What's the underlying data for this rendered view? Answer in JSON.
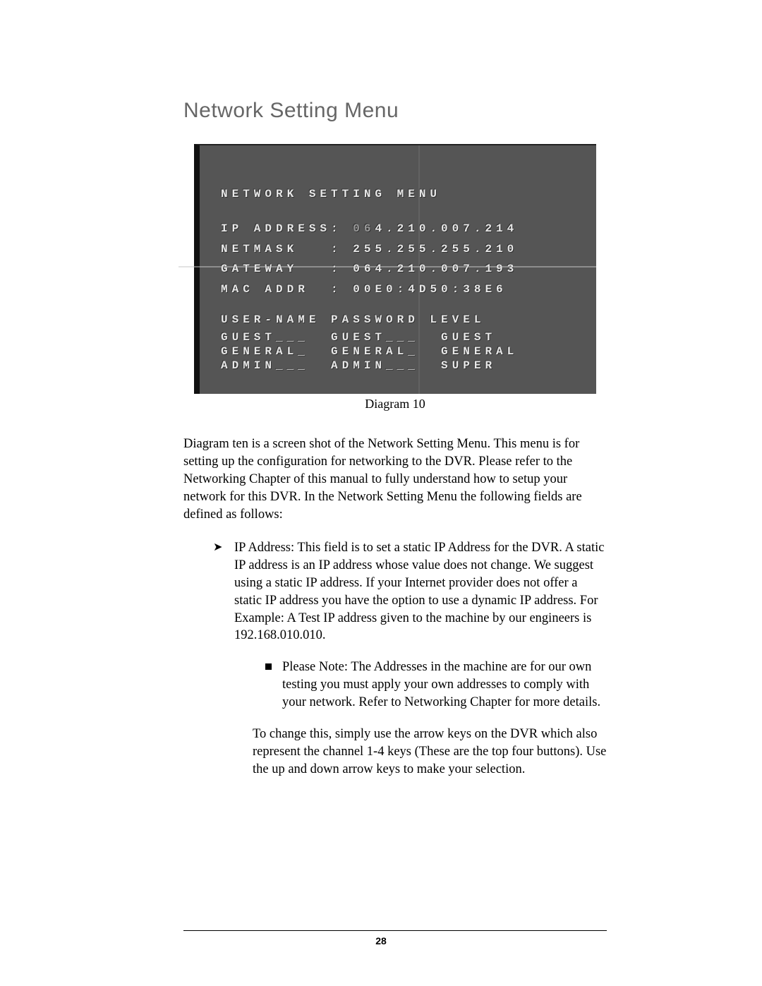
{
  "section_title": "Network Setting Menu",
  "crt": {
    "title": "NETWORK SETTING MENU",
    "rows": [
      {
        "label": "IP ADDRESS:",
        "value_prefix": "06",
        "value_rest": "4.210.007.214"
      },
      {
        "label": "NETMASK   :",
        "value": "255.255.255.210"
      },
      {
        "label": "GATEWAY   :",
        "value": "064.210.007.193",
        "strike": true
      },
      {
        "label": "MAC ADDR  :",
        "value": "00E0:4D50:38E6"
      }
    ],
    "user_header": "USER-NAME PASSWORD LEVEL",
    "users": [
      {
        "u": "GUEST___",
        "p": "GUEST___",
        "l": "GUEST"
      },
      {
        "u": "GENERAL_",
        "p": "GENERAL_",
        "l": "GENERAL"
      },
      {
        "u": "ADMIN___",
        "p": "ADMIN___",
        "l": "SUPER"
      }
    ]
  },
  "caption": "Diagram 10",
  "paragraph_intro": "Diagram ten is a screen shot of the Network Setting Menu. This menu is for setting up the configuration for networking to the DVR. Please refer to the Networking Chapter of this manual to fully understand how to setup your network for this DVR. In the Network Setting Menu the following fields are defined as follows:",
  "bullet_ip": "IP Address: This field is to set a static IP Address for the DVR. A static IP address is an IP address whose value does not change. We suggest using a static IP address. If your Internet provider does not offer a static IP address you have the option to use a dynamic IP address. For Example: A Test IP address given to the machine by our engineers is 192.168.010.010.",
  "sub_note": "Please Note: The Addresses in the machine are for our own testing you must apply your own addresses to comply with your network. Refer to Networking Chapter for more details.",
  "followup": "To change this, simply use the arrow keys on the DVR which also represent the channel 1-4 keys (These are the top four buttons). Use the up and down arrow keys to make your selection.",
  "page_number": "28"
}
